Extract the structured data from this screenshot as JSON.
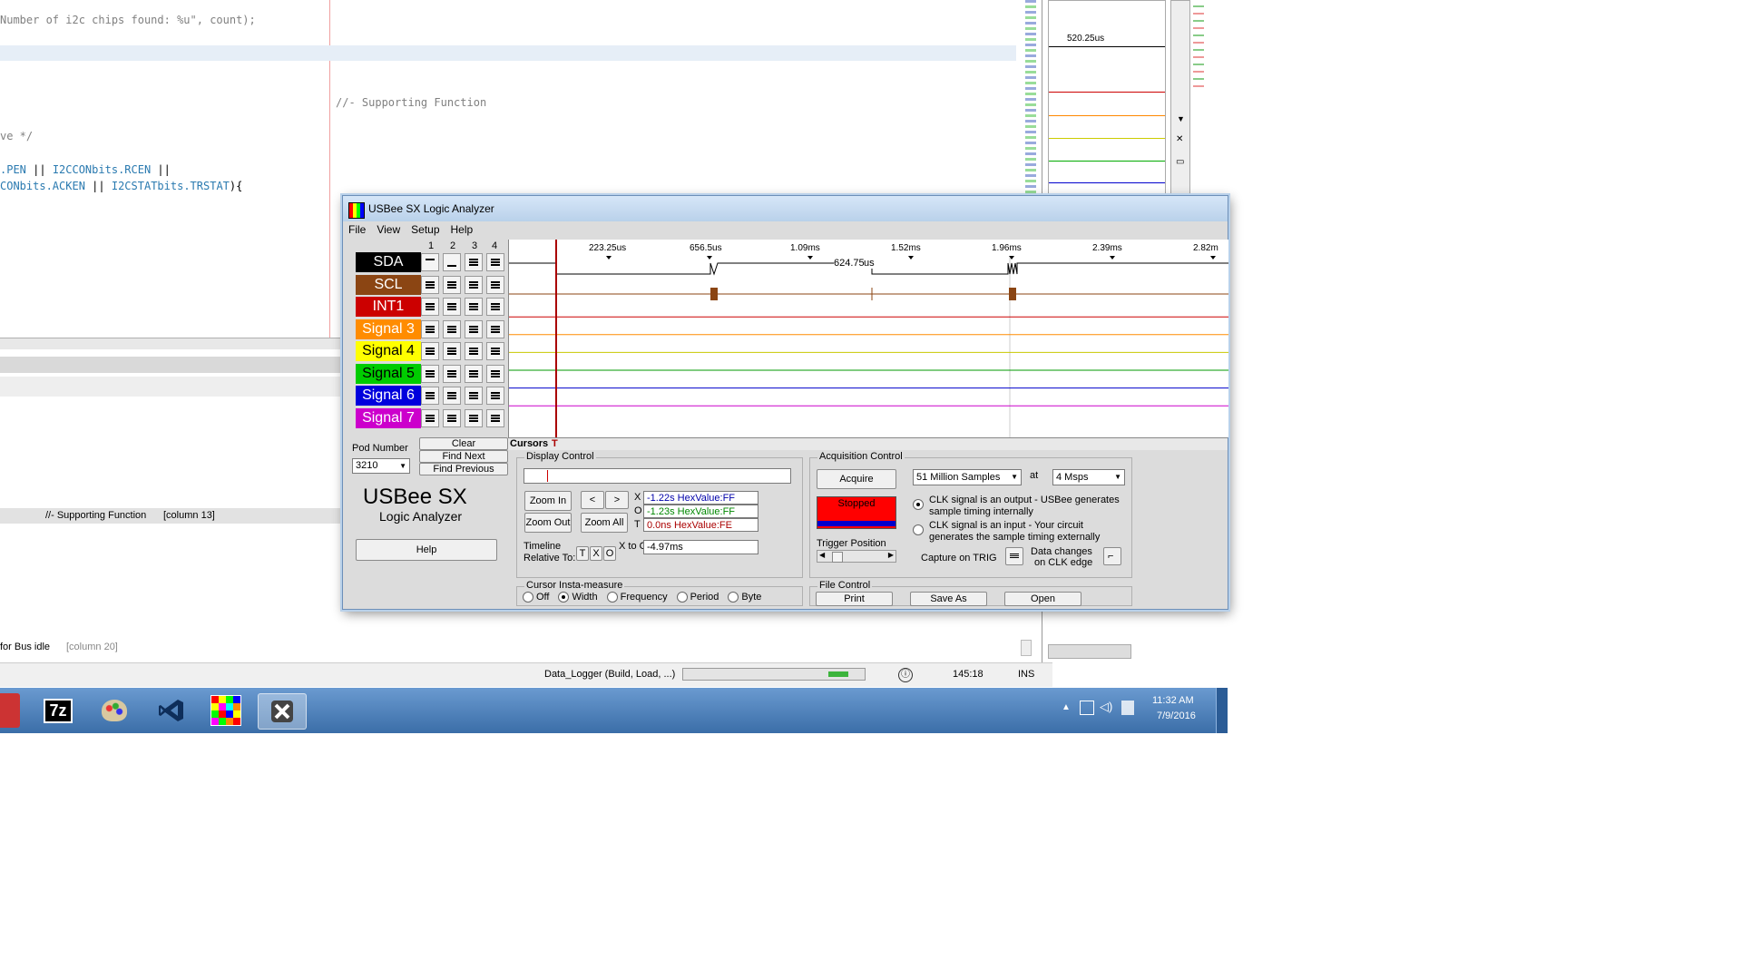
{
  "ide": {
    "code_lines": [
      "Number of i2c chips found: %u\", count);",
      "//- Supporting Function",
      "ve */"
    ],
    "code_line4_parts": [
      ".PEN",
      " || ",
      "I2CCONbits",
      ".RCEN",
      " ||"
    ],
    "code_line5_parts": [
      "CONbits",
      ".ACKEN",
      " || ",
      "I2CSTATbits",
      ".TRSTAT",
      "){"
    ],
    "find_results": [
      {
        "text": "//- Supporting Function",
        "column": "[column 13]"
      },
      {
        "text": "for Bus idle",
        "column": "[column 20]"
      }
    ],
    "status": {
      "project": "Data_Logger (Build, Load, ...)",
      "position": "145:18",
      "mode": "INS"
    },
    "right_panel_time": "520.25us"
  },
  "window": {
    "title": "USBee SX Logic Analyzer"
  },
  "menu": [
    "File",
    "View",
    "Setup",
    "Help"
  ],
  "columns": [
    "1",
    "2",
    "3",
    "4"
  ],
  "signals": [
    {
      "name": "SDA",
      "bg": "#000000",
      "fg": "#ffffff",
      "line": "#000000"
    },
    {
      "name": "SCL",
      "bg": "#8b4513",
      "fg": "#ffffff",
      "line": "#8b4513"
    },
    {
      "name": "INT1",
      "bg": "#cc0000",
      "fg": "#ffffff",
      "line": "#cc0000"
    },
    {
      "name": "Signal 3",
      "bg": "#ff8c00",
      "fg": "#ffffff",
      "line": "#ff8c00"
    },
    {
      "name": "Signal 4",
      "bg": "#ffff00",
      "fg": "#000000",
      "line": "#c8c800"
    },
    {
      "name": "Signal 5",
      "bg": "#00cc00",
      "fg": "#000000",
      "line": "#009900"
    },
    {
      "name": "Signal 6",
      "bg": "#0000dd",
      "fg": "#ffffff",
      "line": "#0000cc"
    },
    {
      "name": "Signal 7",
      "bg": "#cc00cc",
      "fg": "#ffffff",
      "line": "#cc00cc"
    }
  ],
  "timeline": {
    "ticks": [
      "223.25us",
      "656.5us",
      "1.09ms",
      "1.52ms",
      "1.96ms",
      "2.39ms",
      "2.82m"
    ],
    "measure": "624.75",
    "measure_unit": "us",
    "cursors_label": "Cursors",
    "cursor_t": "T"
  },
  "search": {
    "clear": "Clear",
    "find_next": "Find Next",
    "find_previous": "Find Previous"
  },
  "pod": {
    "label": "Pod Number",
    "value": "3210"
  },
  "brand": {
    "title": "USBee SX",
    "subtitle": "Logic Analyzer"
  },
  "help_button": "Help",
  "display_control": {
    "label": "Display Control",
    "zoom_in": "Zoom In",
    "zoom_out": "Zoom Out",
    "zoom_all": "Zoom All",
    "prev": "<",
    "next": ">",
    "x_label": "X",
    "x_value": "-1.22s HexValue:FF",
    "o_label": "O",
    "o_value": "-1.23s HexValue:FF",
    "t_label": "T",
    "t_value": "0.0ns HexValue:FE",
    "timeline_label_1": "Timeline",
    "timeline_label_2": "Relative To:",
    "rel_t": "T",
    "rel_x": "X",
    "rel_o": "O",
    "x_to_o_label": "X to O",
    "x_to_o_value": "-4.97ms"
  },
  "insta": {
    "label": "Cursor Insta-measure",
    "options": [
      "Off",
      "Width",
      "Frequency",
      "Period",
      "Byte"
    ],
    "selected": "Width"
  },
  "acquisition": {
    "label": "Acquisition Control",
    "acquire": "Acquire",
    "samples": "51 Million Samples",
    "at": "at",
    "rate": "4 Msps",
    "status": "Stopped",
    "clk_output_1": "CLK signal is an output - USBee generates",
    "clk_output_2": "sample timing internally",
    "clk_input_1": "CLK signal is an input - Your circuit",
    "clk_input_2": "generates the sample timing externally",
    "trigger_position": "Trigger Position",
    "capture_on_trig": "Capture on TRIG",
    "data_changes_1": "Data changes",
    "data_changes_2": "on CLK edge"
  },
  "file_control": {
    "label": "File Control",
    "print": "Print",
    "save_as": "Save As",
    "open": "Open"
  },
  "tray": {
    "time": "11:32 AM",
    "date": "7/9/2016"
  },
  "taskbar_apps": [
    "7z"
  ],
  "colors": {
    "stopped": "#ff0000",
    "taskbar": "#4a7fbe",
    "cursor": "#aa0000"
  }
}
